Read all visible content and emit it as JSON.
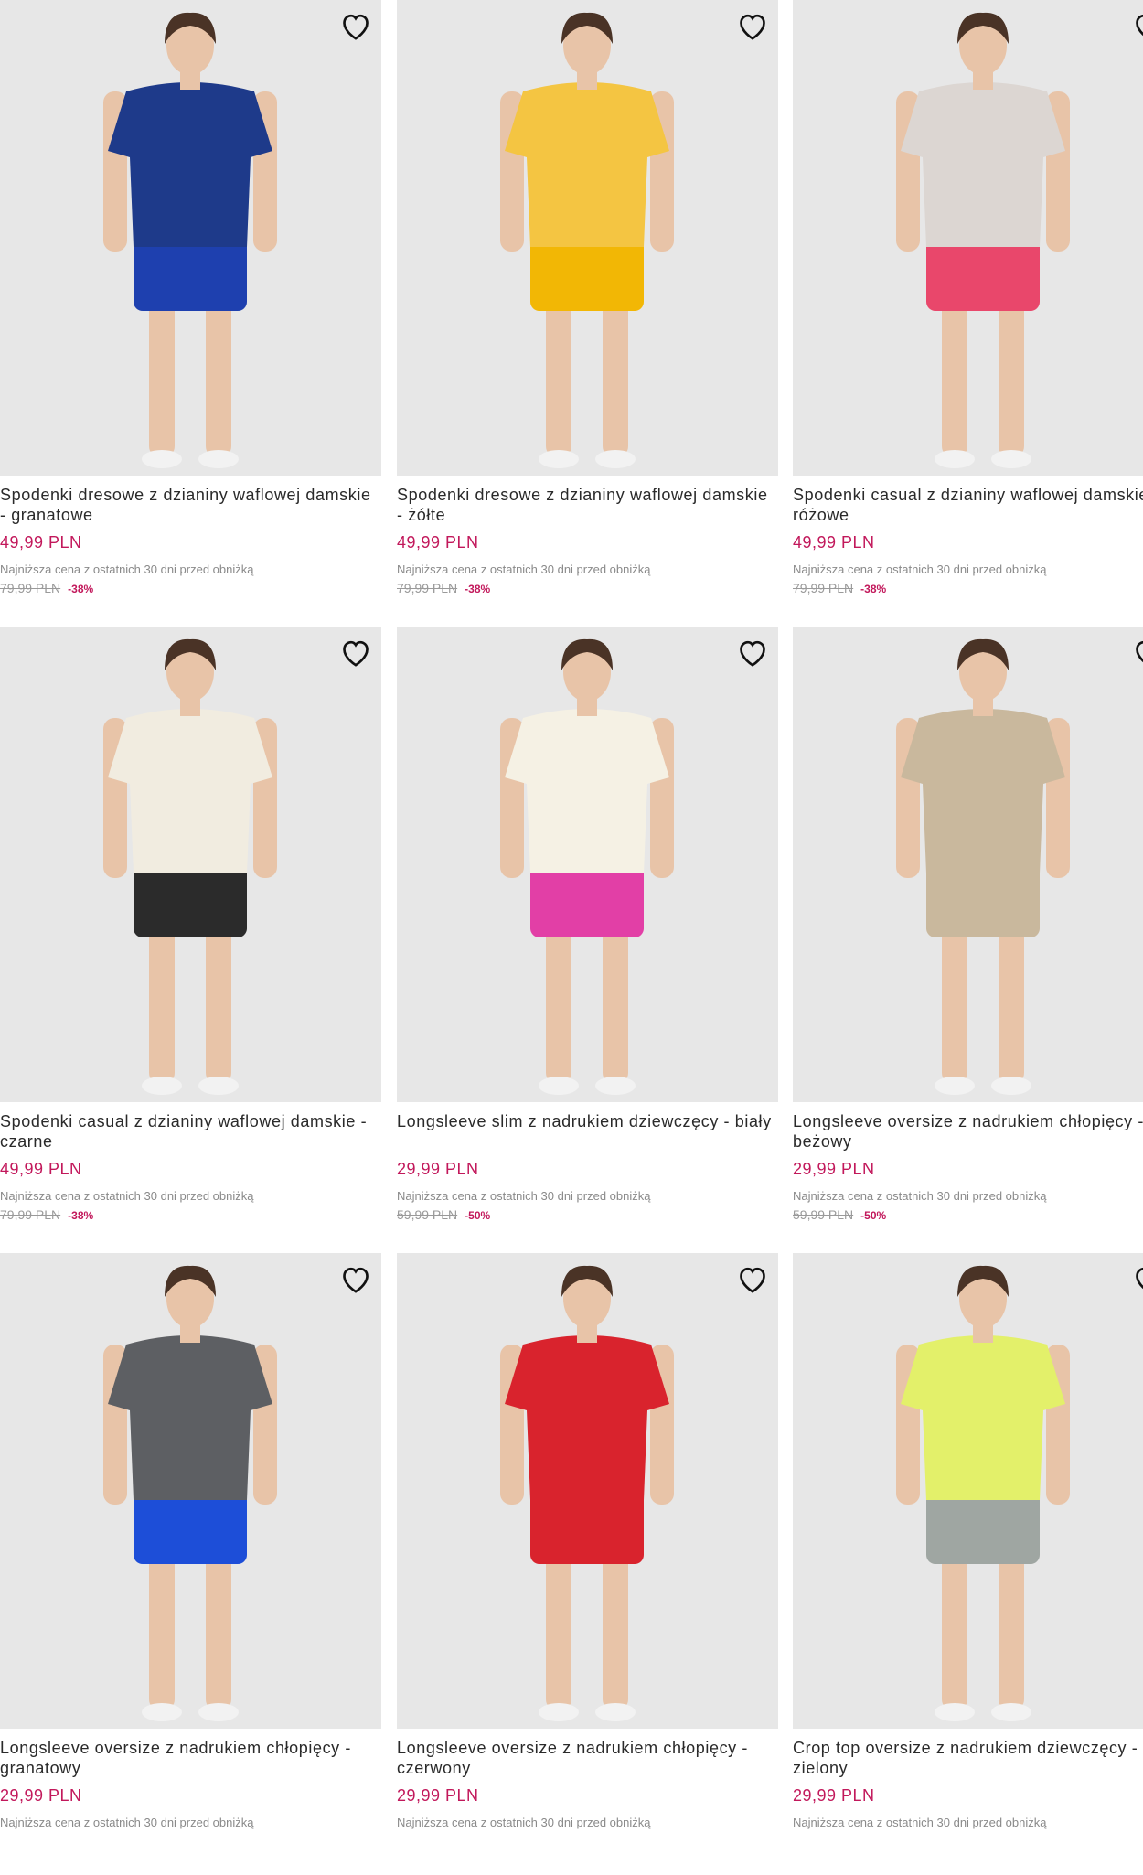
{
  "colors": {
    "price": "#c2185b",
    "discount": "#c2185b",
    "old_price": "#9a9a9a",
    "photo_bg": "#e7e7e7"
  },
  "icons": {
    "wishlist": "heart-outline-icon"
  },
  "products": [
    {
      "name": "Spodenki dresowe z dzianiny waflowej damskie - granatowe",
      "price": "49,99 PLN",
      "lowest_label": "Najniższa cena z ostatnich 30 dni przed obniżką",
      "old_price": "79,99 PLN",
      "discount": "-38%",
      "top_color": "#1e3a8a",
      "bottom_color": "#1e40af"
    },
    {
      "name": "Spodenki dresowe z dzianiny waflowej damskie - żółte",
      "price": "49,99 PLN",
      "lowest_label": "Najniższa cena z ostatnich 30 dni przed obniżką",
      "old_price": "79,99 PLN",
      "discount": "-38%",
      "top_color": "#f4c542",
      "bottom_color": "#f2b705"
    },
    {
      "name": "Spodenki casual z dzianiny waflowej damskie - różowe",
      "price": "49,99 PLN",
      "lowest_label": "Najniższa cena z ostatnich 30 dni przed obniżką",
      "old_price": "79,99 PLN",
      "discount": "-38%",
      "top_color": "#dcd6d2",
      "bottom_color": "#e9476b"
    },
    {
      "name": "Spodenki casual z dzianiny waflowej damskie - czarne",
      "price": "49,99 PLN",
      "lowest_label": "Najniższa cena z ostatnich 30 dni przed obniżką",
      "old_price": "79,99 PLN",
      "discount": "-38%",
      "top_color": "#f1ece0",
      "bottom_color": "#2b2b2b"
    },
    {
      "name": "Longsleeve slim z nadrukiem dziewczęcy - biały",
      "price": "29,99 PLN",
      "lowest_label": "Najniższa cena z ostatnich 30 dni przed obniżką",
      "old_price": "59,99 PLN",
      "discount": "-50%",
      "top_color": "#f5f1e4",
      "bottom_color": "#e23fa6"
    },
    {
      "name": "Longsleeve oversize z nadrukiem chłopięcy - beżowy",
      "price": "29,99 PLN",
      "lowest_label": "Najniższa cena z ostatnich 30 dni przed obniżką",
      "old_price": "59,99 PLN",
      "discount": "-50%",
      "top_color": "#c9b89d",
      "bottom_color": "#c9b89d"
    },
    {
      "name": "Longsleeve oversize z nadrukiem chłopięcy - granatowy",
      "price": "29,99 PLN",
      "lowest_label": "Najniższa cena z ostatnich 30 dni przed obniżką",
      "old_price": "",
      "discount": "",
      "top_color": "#5d5f63",
      "bottom_color": "#1d4ed8"
    },
    {
      "name": "Longsleeve oversize z nadrukiem chłopięcy - czerwony",
      "price": "29,99 PLN",
      "lowest_label": "Najniższa cena z ostatnich 30 dni przed obniżką",
      "old_price": "",
      "discount": "",
      "top_color": "#d9232d",
      "bottom_color": "#d9232d"
    },
    {
      "name": "Crop top oversize z nadrukiem dziewczęcy - zielony",
      "price": "29,99 PLN",
      "lowest_label": "Najniższa cena z ostatnich 30 dni przed obniżką",
      "old_price": "",
      "discount": "",
      "top_color": "#e3f06a",
      "bottom_color": "#9fa6a2"
    }
  ]
}
